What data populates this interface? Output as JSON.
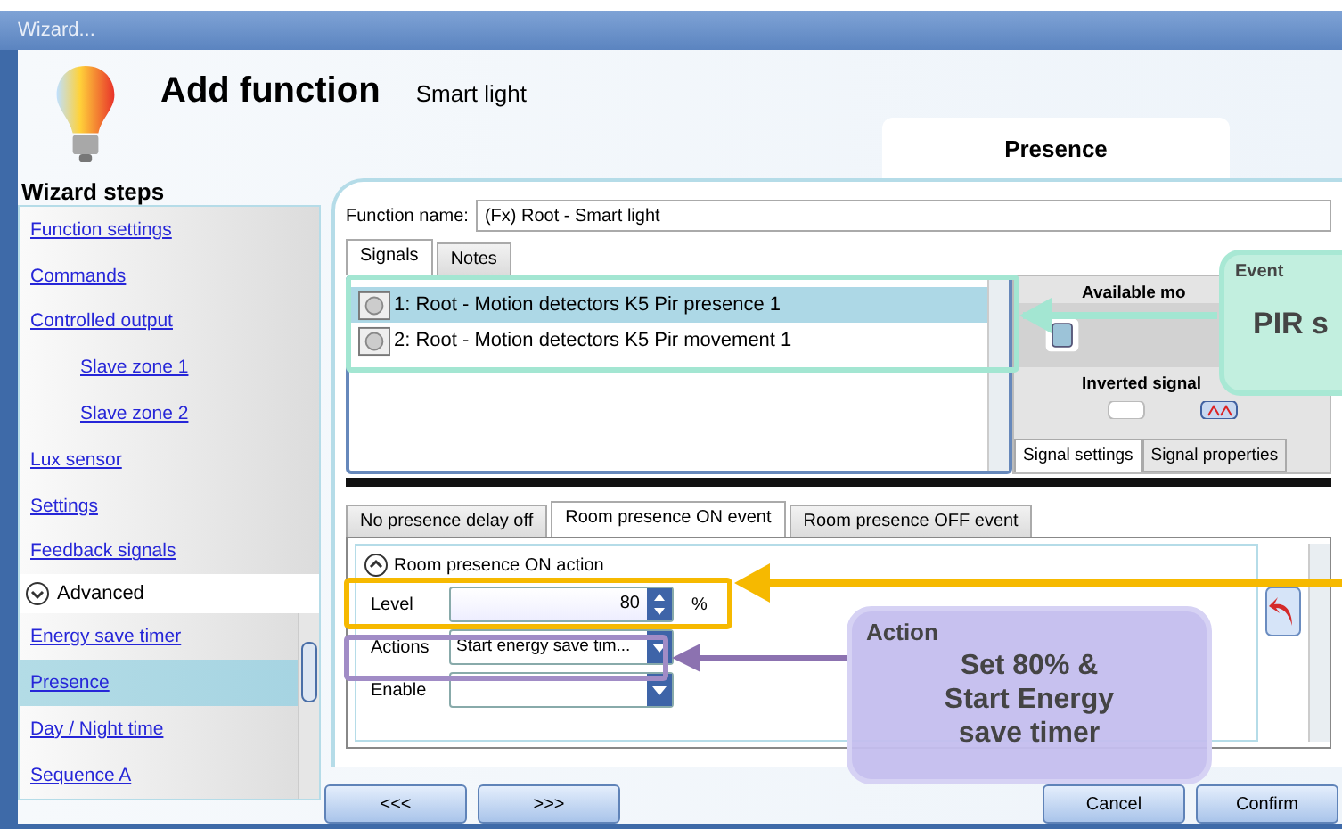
{
  "window": {
    "title": "Wizard..."
  },
  "header": {
    "title": "Add function",
    "subtitle": "Smart light",
    "page_tab": "Presence"
  },
  "sidebar": {
    "title": "Wizard steps",
    "items": [
      {
        "label": "Function settings",
        "selected": false
      },
      {
        "label": "Commands",
        "selected": false
      },
      {
        "label": "Controlled output",
        "selected": false,
        "children": [
          {
            "label": "Slave zone 1",
            "selected": false
          },
          {
            "label": "Slave zone 2",
            "selected": false
          }
        ]
      },
      {
        "label": "Lux sensor",
        "selected": false
      },
      {
        "label": "Settings",
        "selected": false
      },
      {
        "label": "Feedback signals",
        "selected": false
      }
    ],
    "advanced": {
      "label": "Advanced",
      "expanded": true,
      "items": [
        {
          "label": "Energy save timer",
          "selected": false
        },
        {
          "label": "Presence",
          "selected": true
        },
        {
          "label": "Day / Night time",
          "selected": false
        },
        {
          "label": "Sequence A",
          "selected": false
        }
      ]
    }
  },
  "function_name": {
    "label": "Function name:",
    "value": "(Fx) Root - Smart light"
  },
  "signal_tabs": [
    {
      "label": "Signals",
      "selected": true
    },
    {
      "label": "Notes",
      "selected": false
    }
  ],
  "signals": [
    {
      "label": "1: Root - Motion detectors K5 Pir presence 1",
      "selected": true
    },
    {
      "label": "2: Root - Motion detectors K5 Pir movement 1",
      "selected": false
    }
  ],
  "side_panel": {
    "available_heading": "Available mo",
    "inverted_heading": "Inverted signal",
    "tabs": [
      {
        "label": "Signal settings",
        "selected": true
      },
      {
        "label": "Signal properties",
        "selected": false
      }
    ]
  },
  "event_tabs": [
    {
      "label": "No presence delay off",
      "selected": false
    },
    {
      "label": "Room presence ON event",
      "selected": true
    },
    {
      "label": "Room presence OFF event",
      "selected": false
    }
  ],
  "action_section": {
    "label": "Room presence ON action",
    "expanded": true,
    "level": {
      "label": "Level",
      "value": "80",
      "unit": "%"
    },
    "actions": {
      "label": "Actions",
      "value": "Start energy save tim..."
    },
    "enable": {
      "label": "Enable"
    }
  },
  "callouts": [
    {
      "kind": "event",
      "title": "Event",
      "body": "PIR s"
    },
    {
      "kind": "action",
      "title": "Action",
      "body": "Set 80% & Start Energy save timer"
    }
  ],
  "buttons": [
    {
      "label": "<<<",
      "kind": "nav"
    },
    {
      "label": ">>>",
      "kind": "nav"
    },
    {
      "label": "Cancel",
      "kind": "dialog"
    },
    {
      "label": "Confirm",
      "kind": "dialog"
    }
  ]
}
